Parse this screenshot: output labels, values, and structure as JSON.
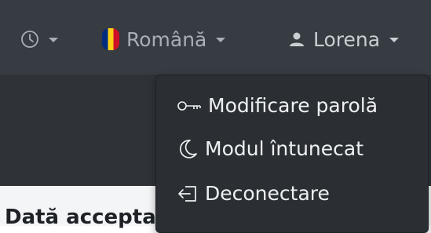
{
  "header": {
    "clock_icon": "clock-icon",
    "language": {
      "label": "Română",
      "flag_icon": "romania-flag-icon",
      "flag_colors": [
        "#002B7F",
        "#FCD116",
        "#CE1126"
      ]
    },
    "user": {
      "label": "Lorena",
      "icon": "user-icon"
    }
  },
  "user_menu": {
    "items": [
      {
        "label": "Modificare parolă",
        "icon": "key-icon"
      },
      {
        "label": "Modul întunecat",
        "icon": "moon-icon"
      },
      {
        "label": "Deconectare",
        "icon": "logout-icon"
      }
    ]
  },
  "page": {
    "heading_partial": "Dată accepta"
  },
  "colors": {
    "topbar": "#373c43",
    "dropdown": "#2b2f34",
    "menu_text": "#eef0f2",
    "nav_text": "#a8aeb5"
  }
}
